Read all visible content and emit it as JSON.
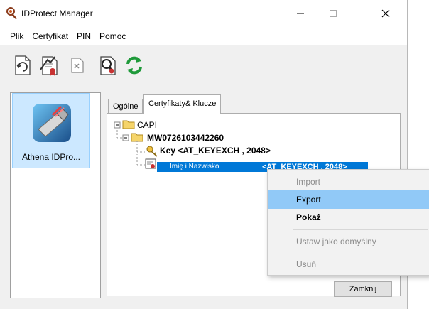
{
  "window": {
    "title": "IDProtect Manager"
  },
  "menu": {
    "items": [
      "Plik",
      "Certyfikat",
      "PIN",
      "Pomoc"
    ]
  },
  "toolbar": {
    "icons": [
      "refresh-document-icon",
      "certificate-export-icon",
      "delete-document-icon",
      "inspect-certificate-icon",
      "sync-refresh-icon"
    ]
  },
  "device": {
    "label": "Athena IDPro..."
  },
  "tabs": [
    {
      "label": "Ogólne"
    },
    {
      "label": "Certyfikaty& Klucze"
    }
  ],
  "tree": {
    "root": "CAPI",
    "container": "MW0726103442260",
    "key": "Key  <AT_KEYEXCH , 2048>",
    "cert_name": "Imię i Nazwisko",
    "cert_key": "<AT_KEYEXCH , 2048>"
  },
  "context_menu": {
    "items": [
      {
        "label": "Import",
        "enabled": false
      },
      {
        "label": "Export",
        "enabled": true,
        "highlighted": true
      },
      {
        "label": "Pokaż",
        "enabled": true,
        "bold": true
      },
      {
        "label": "Ustaw jako domyślny",
        "enabled": false
      },
      {
        "label": "Usuń",
        "enabled": false
      }
    ]
  },
  "buttons": {
    "close": "Zamknij"
  },
  "colors": {
    "selection": "#0078d7",
    "menu_highlight": "#91c9f7",
    "device_selected": "#cce8ff"
  }
}
